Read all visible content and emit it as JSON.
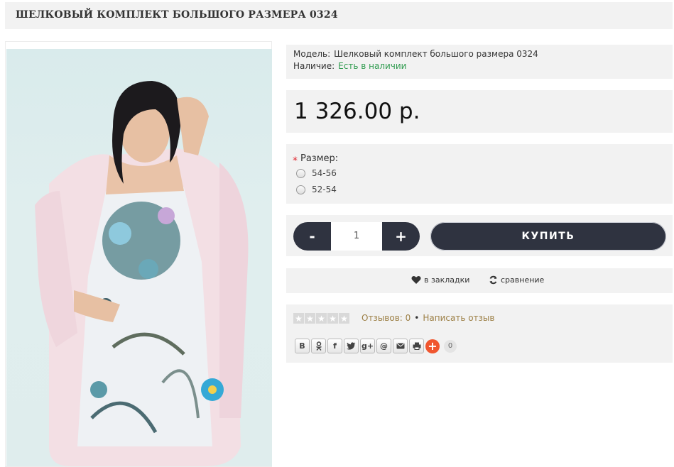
{
  "product": {
    "title": "ШЕЛКОВЫЙ КОМПЛЕКТ БОЛЬШОГО РАЗМЕРА 0324"
  },
  "info": {
    "model_label": "Модель:",
    "model_value": "Шелковый комплект большого размера 0324",
    "stock_label": "Наличие:",
    "stock_value": "Есть в наличии"
  },
  "price": "1 326.00 р.",
  "options": {
    "required_mark": "*",
    "size_label": "Размер:",
    "sizes": [
      "54-56",
      "52-54"
    ]
  },
  "buy": {
    "minus": "-",
    "quantity": "1",
    "plus": "+",
    "buy_label": "КУПИТЬ"
  },
  "actions": {
    "bookmark": "в закладки",
    "compare": "сравнение"
  },
  "reviews": {
    "rating": 0,
    "reviews_count": "Отзывов: 0",
    "separator": "•",
    "write_review": "Написать отзыв"
  },
  "share": {
    "buttons": [
      "В",
      "ok",
      "f",
      "twitter",
      "g+",
      "@",
      "mail",
      "print",
      "+"
    ],
    "count": "0"
  },
  "colors": {
    "accent_dark": "#2f3340",
    "in_stock": "#2e9b4e",
    "review_link": "#9c7f45",
    "share_plus": "#f0562f"
  }
}
